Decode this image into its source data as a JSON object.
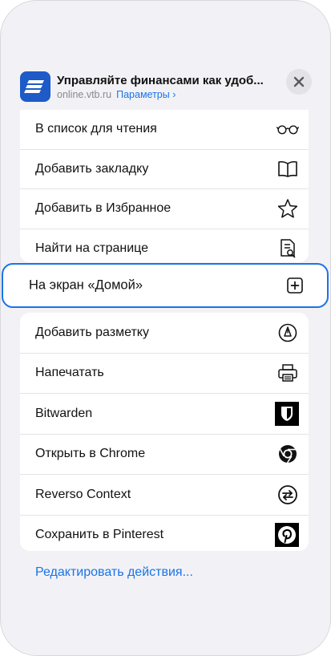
{
  "header": {
    "title": "Управляйте финансами как удоб...",
    "url": "online.vtb.ru",
    "params_link": "Параметры ›"
  },
  "actions_top": [
    {
      "label": "В список для чтения",
      "icon": "glasses-icon"
    },
    {
      "label": "Добавить закладку",
      "icon": "book-icon"
    },
    {
      "label": "Добавить в Избранное",
      "icon": "star-icon"
    },
    {
      "label": "Найти на странице",
      "icon": "find-document-icon"
    }
  ],
  "highlighted_action": {
    "label": "На экран «Домой»",
    "icon": "plus-square-icon"
  },
  "actions_bottom": [
    {
      "label": "Добавить разметку",
      "icon": "markup-pen-icon"
    },
    {
      "label": "Напечатать",
      "icon": "printer-icon"
    },
    {
      "label": "Bitwarden",
      "icon": "bitwarden-shield-icon"
    },
    {
      "label": "Открыть в Chrome",
      "icon": "chrome-icon"
    },
    {
      "label": "Reverso Context",
      "icon": "reverso-icon"
    },
    {
      "label": "Сохранить в Pinterest",
      "icon": "pinterest-icon"
    }
  ],
  "edit_actions_link": "Редактировать действия...",
  "colors": {
    "accent": "#1a73e8",
    "app_icon": "#1e5ac8",
    "background": "#f2f2f6"
  }
}
